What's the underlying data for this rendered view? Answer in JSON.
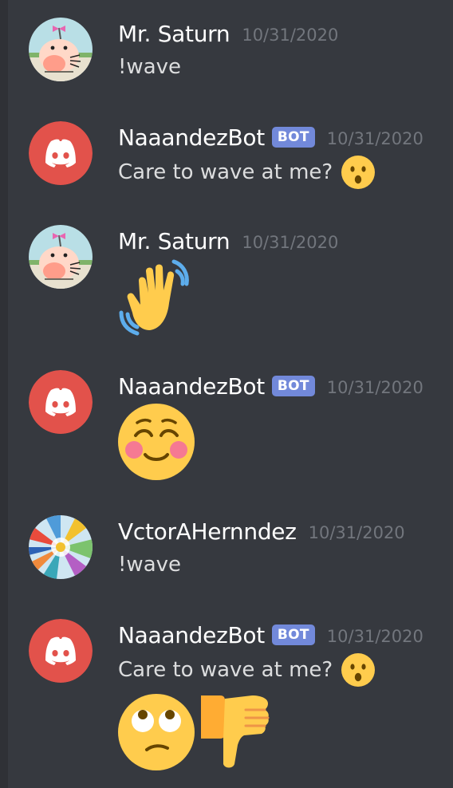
{
  "messages": [
    {
      "username": "Mr. Saturn",
      "bot_tag": "",
      "timestamp": "10/31/2020",
      "text": "!wave",
      "avatar": "mr-saturn-avatar",
      "emojis": []
    },
    {
      "username": "NaaandezBot",
      "bot_tag": "BOT",
      "timestamp": "10/31/2020",
      "text": "Care to wave at me?",
      "avatar": "discord-logo-avatar",
      "emojis": [
        "hushed-face-emoji"
      ]
    },
    {
      "username": "Mr. Saturn",
      "bot_tag": "",
      "timestamp": "10/31/2020",
      "text": "",
      "avatar": "mr-saturn-avatar",
      "emojis": [
        "waving-hand-emoji"
      ]
    },
    {
      "username": "NaaandezBot",
      "bot_tag": "BOT",
      "timestamp": "10/31/2020",
      "text": "",
      "avatar": "discord-logo-avatar",
      "emojis": [
        "relieved-blushing-face-emoji"
      ]
    },
    {
      "username": "VctorAHernndez",
      "bot_tag": "",
      "timestamp": "10/31/2020",
      "text": "!wave",
      "avatar": "colorful-abstract-avatar",
      "emojis": []
    },
    {
      "username": "NaaandezBot",
      "bot_tag": "BOT",
      "timestamp": "10/31/2020",
      "text": "Care to wave at me?",
      "avatar": "discord-logo-avatar",
      "emojis": [
        "hushed-face-emoji",
        "face-with-rolling-eyes-emoji",
        "thumbs-down-emoji"
      ]
    }
  ],
  "colors": {
    "background": "#36393f",
    "username": "#ffffff",
    "message_text": "#dcddde",
    "timestamp": "#72767d",
    "bot_tag": "#7289da",
    "discord_red": "#e2524b",
    "emoji_yellow": "#ffcc4d"
  }
}
